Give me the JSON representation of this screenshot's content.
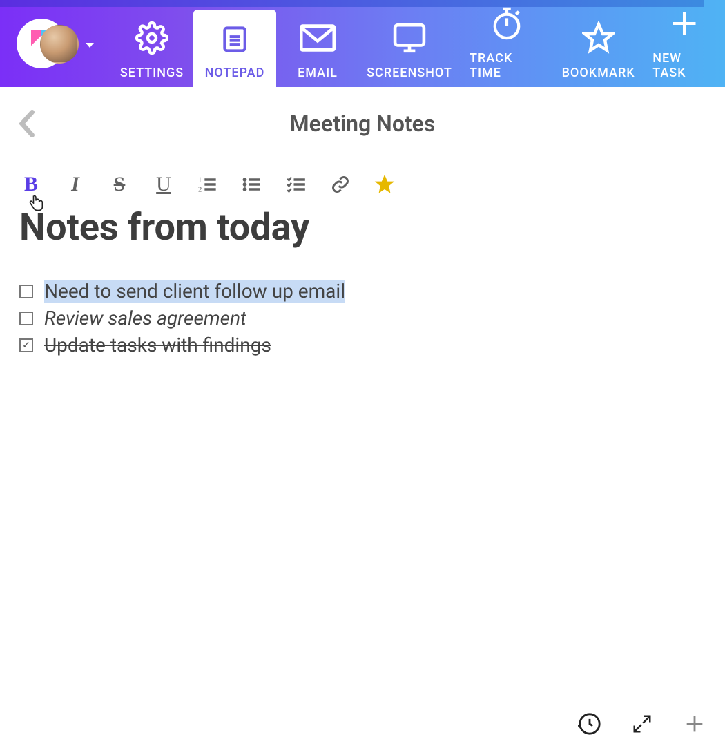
{
  "nav": {
    "items": [
      {
        "id": "settings",
        "label": "SETTINGS",
        "icon": "gear-icon"
      },
      {
        "id": "notepad",
        "label": "NOTEPAD",
        "icon": "notepad-icon",
        "active": true
      },
      {
        "id": "email",
        "label": "EMAIL",
        "icon": "mail-icon"
      },
      {
        "id": "screenshot",
        "label": "SCREENSHOT",
        "icon": "monitor-icon"
      },
      {
        "id": "tracktime",
        "label": "TRACK TIME",
        "icon": "stopwatch-icon"
      },
      {
        "id": "bookmark",
        "label": "BOOKMARK",
        "icon": "star-icon"
      },
      {
        "id": "newtask",
        "label": "NEW TASK",
        "icon": "plus-icon"
      }
    ]
  },
  "header": {
    "title": "Meeting Notes"
  },
  "toolbar": {
    "bold": "B",
    "italic": "I",
    "strike": "S",
    "underline": "U"
  },
  "document": {
    "title": "Notes from today",
    "checklist": [
      {
        "text": "Need to send client follow up email",
        "checked": false,
        "selected": true,
        "style": "normal"
      },
      {
        "text": "Review sales agreement",
        "checked": false,
        "selected": false,
        "style": "italic"
      },
      {
        "text": "Update tasks with findings",
        "checked": true,
        "selected": false,
        "style": "strike"
      }
    ]
  },
  "colors": {
    "accent": "#6c5ce7",
    "highlight": "#c7dbf5",
    "star": "#e6b800"
  }
}
